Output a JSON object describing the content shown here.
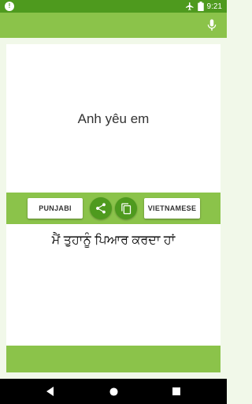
{
  "status_bar": {
    "time": "9:21",
    "icons": [
      "notification-icon",
      "airplane-icon",
      "battery-icon"
    ]
  },
  "app_bar": {
    "mic_icon": "microphone-icon"
  },
  "source": {
    "text": "Anh yêu em"
  },
  "controls": {
    "source_language": "PUNJABI",
    "target_language": "VIETNAMESE",
    "share_icon": "share-icon",
    "copy_icon": "copy-icon"
  },
  "translation": {
    "text": "ਮੈਂ ਤੁਹਾਨੂੰ ਪਿਆਰ ਕਰਦਾ ਹਾਂ"
  },
  "navigation": {
    "icons": [
      "back-icon",
      "home-icon",
      "recent-apps-icon"
    ]
  },
  "colors": {
    "primary": "#8bc34a",
    "primary_dark": "#4e9a1e",
    "background": "#f1f8e9"
  }
}
